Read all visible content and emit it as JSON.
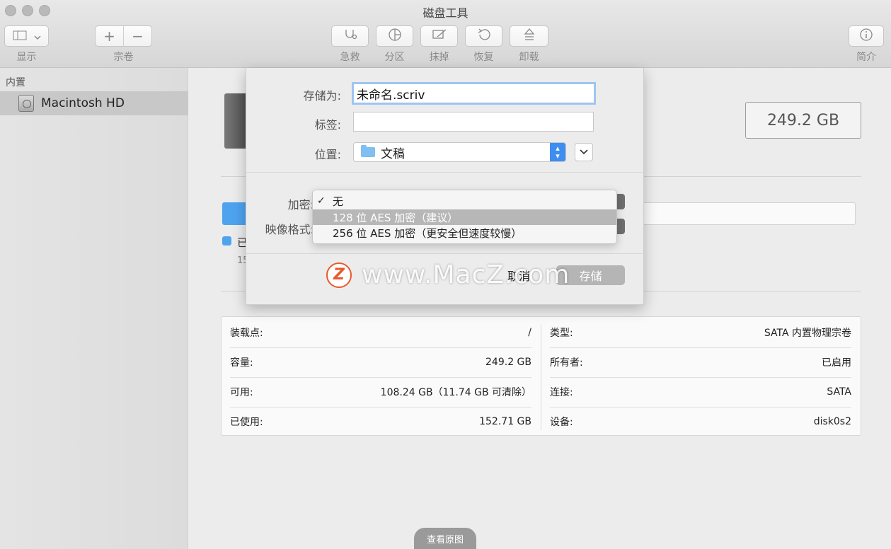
{
  "window": {
    "title": "磁盘工具"
  },
  "toolbar": {
    "view_label": "显示",
    "volume_label": "宗卷",
    "firstaid_label": "急救",
    "partition_label": "分区",
    "erase_label": "抹掉",
    "restore_label": "恢复",
    "unmount_label": "卸载",
    "info_label": "简介"
  },
  "sidebar": {
    "section": "内置",
    "items": [
      {
        "label": "Macintosh HD"
      }
    ]
  },
  "main": {
    "capacity": "249.2 GB",
    "legend_label": "已",
    "legend_sub": "15"
  },
  "info": {
    "left": [
      {
        "key": "装载点:",
        "value": "/"
      },
      {
        "key": "容量:",
        "value": "249.2 GB"
      },
      {
        "key": "可用:",
        "value": "108.24 GB（11.74 GB 可清除）"
      },
      {
        "key": "已使用:",
        "value": "152.71 GB"
      }
    ],
    "right": [
      {
        "key": "类型:",
        "value": "SATA 内置物理宗卷"
      },
      {
        "key": "所有者:",
        "value": "已启用"
      },
      {
        "key": "连接:",
        "value": "SATA"
      },
      {
        "key": "设备:",
        "value": "disk0s2"
      }
    ]
  },
  "dialog": {
    "save_as_label": "存储为:",
    "save_as_value": "未命名.scriv",
    "tags_label": "标签:",
    "tags_value": "",
    "location_label": "位置:",
    "location_value": "文稿",
    "encryption_label": "加密:",
    "format_label": "映像格式:",
    "encryption_options": [
      {
        "label": "无",
        "checked": true,
        "highlighted": false
      },
      {
        "label": "128 位 AES 加密（建议）",
        "checked": false,
        "highlighted": true
      },
      {
        "label": "256 位 AES 加密（更安全但速度较慢）",
        "checked": false,
        "highlighted": false
      }
    ],
    "cancel_label": "取消",
    "save_label": "存储"
  },
  "overlay": {
    "watermark": "www.MacZ.com",
    "view_original": "查看原图"
  },
  "colors": {
    "accent": "#3d8ef0",
    "usage_blue": "#4ea3ef",
    "watermark_orange": "#e85a2a"
  }
}
